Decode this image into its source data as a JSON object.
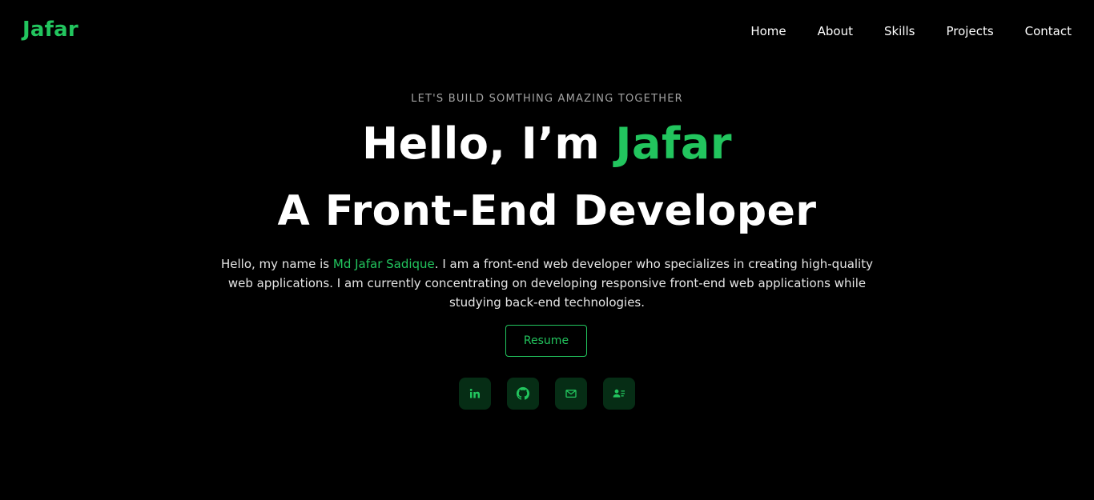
{
  "brand": {
    "logo": "Jafar",
    "accent_color": "#22c55e"
  },
  "nav": {
    "items": [
      {
        "label": "Home"
      },
      {
        "label": "About"
      },
      {
        "label": "Skills"
      },
      {
        "label": "Projects"
      },
      {
        "label": "Contact"
      }
    ]
  },
  "hero": {
    "tagline": "LET'S BUILD SOMTHING AMAZING TOGETHER",
    "greeting": "Hello, I’m ",
    "greeting_name": "Jafar",
    "headline": "A Front-End Developer",
    "intro_before": "Hello, my name is ",
    "intro_name": "Md Jafar Sadique",
    "intro_after": ". I am a front-end web developer who specializes in creating high-quality web applications. I am currently concentrating on developing responsive front-end web applications while studying back-end technologies.",
    "resume_label": "Resume"
  },
  "socials": [
    {
      "icon": "linkedin-icon"
    },
    {
      "icon": "github-icon"
    },
    {
      "icon": "mail-icon"
    },
    {
      "icon": "contact-card-icon"
    }
  ]
}
